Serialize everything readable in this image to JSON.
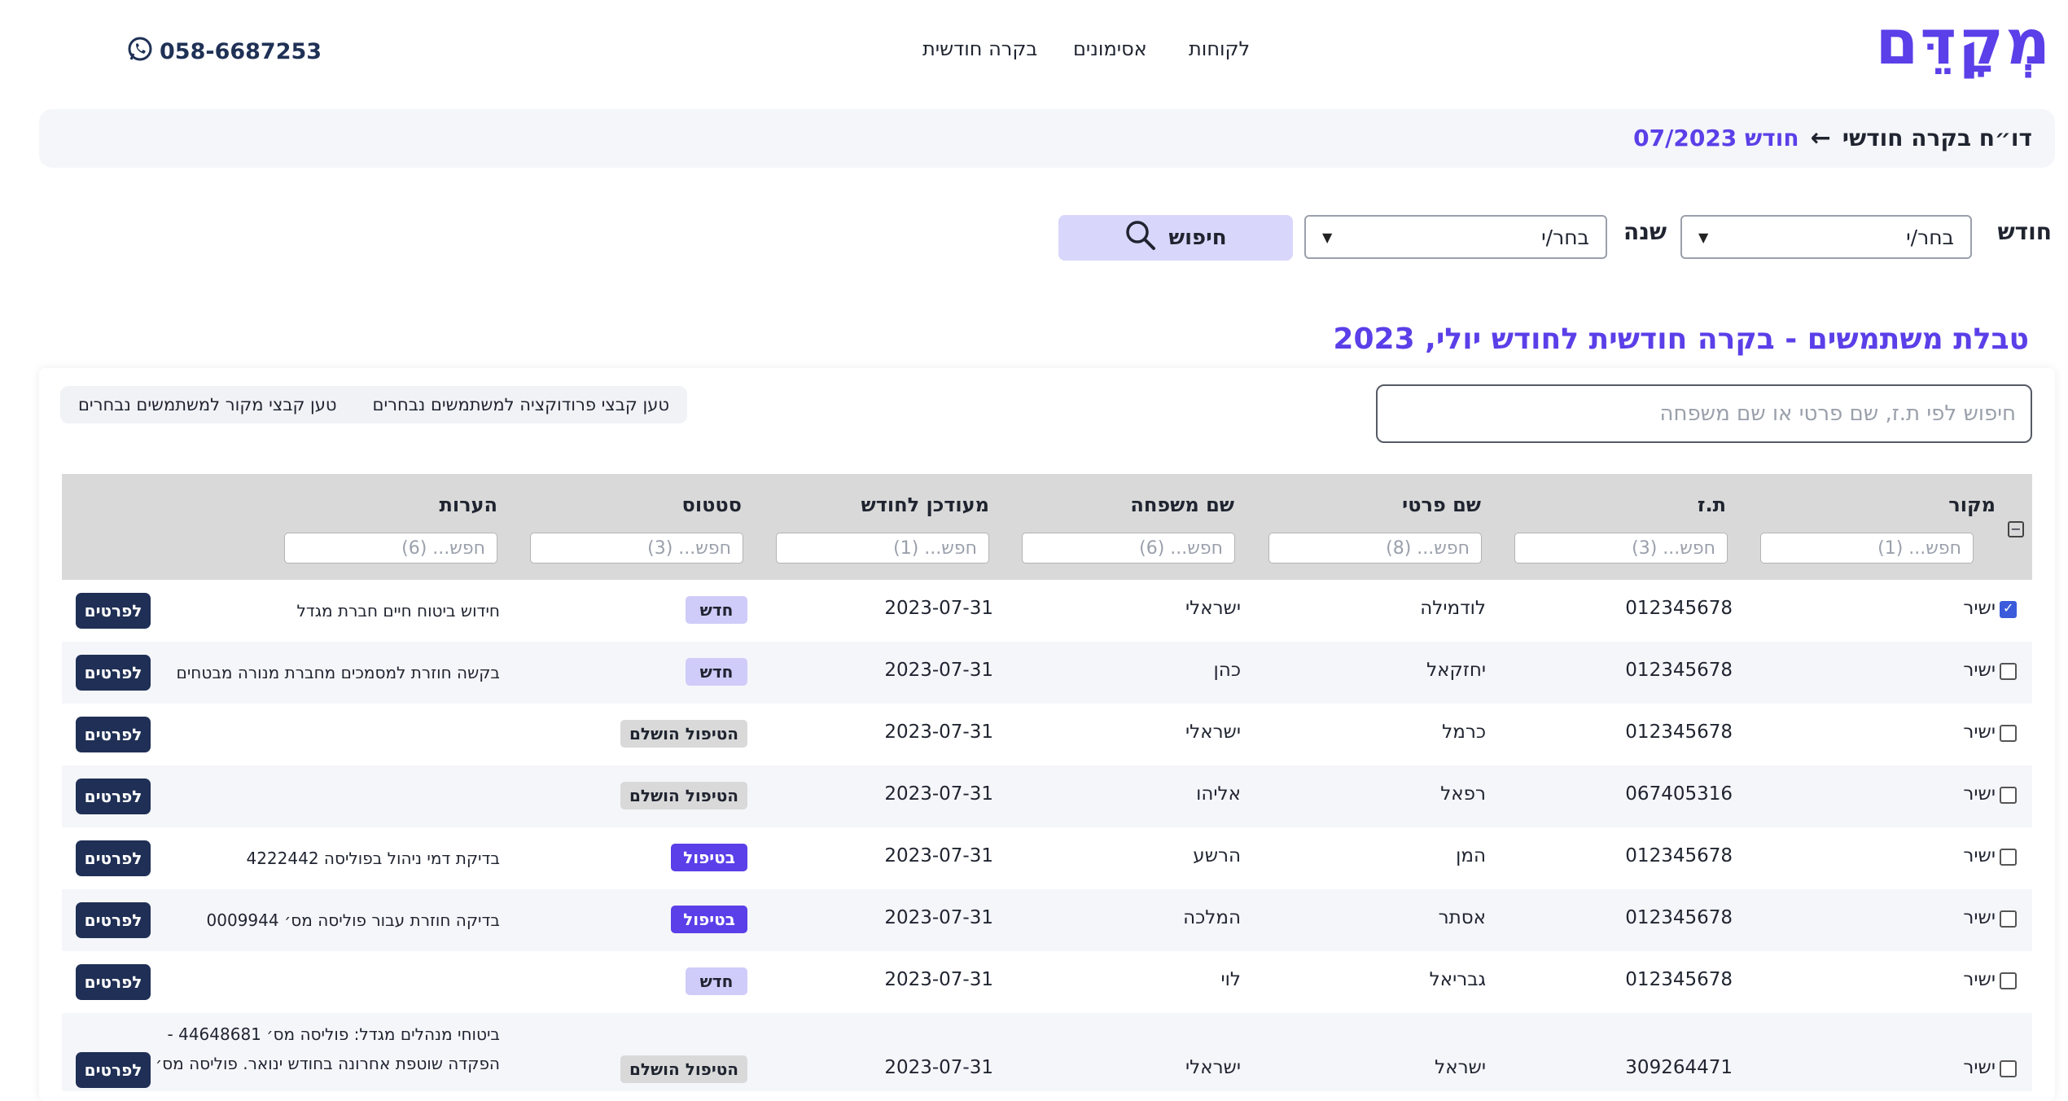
{
  "header": {
    "logo": "מְקָדֵּם",
    "nav": [
      "לקוחות",
      "אסימונים",
      "בקרה חודשית"
    ],
    "phone": "058-6687253"
  },
  "breadcrumb": {
    "parent": "דו״ח בקרה חודשי",
    "arrow": "←",
    "current": "חודש 07/2023"
  },
  "filters": {
    "month_label": "חודש",
    "month_value": "בחר/י",
    "year_label": "שנה",
    "year_value": "בחר/י",
    "search_button": "חיפוש"
  },
  "section_title": "טבלת משתמשים - בקרה חודשית לחודש יולי, 2023",
  "toolbar": {
    "load_production": "טען קבצי פרודוקציה למשתמשים נבחרים",
    "load_source": "טען קבצי מקור למשתמשים נבחרים"
  },
  "global_search_placeholder": "חיפוש לפי ת.ז, שם פרטי או שם משפחה",
  "columns": [
    {
      "label": "מקור",
      "placeholder": "חפש... (1)"
    },
    {
      "label": "ת.ז",
      "placeholder": "חפש... (3)"
    },
    {
      "label": "שם פרטי",
      "placeholder": "חפש... (8)"
    },
    {
      "label": "שם משפחה",
      "placeholder": "חפש... (6)"
    },
    {
      "label": "מעודכן לחודש",
      "placeholder": "חפש... (1)"
    },
    {
      "label": "סטטוס",
      "placeholder": "חפש... (3)"
    },
    {
      "label": "הערות",
      "placeholder": "חפש... (6)"
    }
  ],
  "details_label": "לפרטים",
  "rows": [
    {
      "checked": true,
      "source": "ישיר",
      "id": "012345678",
      "first": "לודמילה",
      "last": "ישראלי",
      "month": "2023-07-31",
      "status": "חדש",
      "status_kind": "new",
      "notes": [
        "חידוש ביטוח חיים חברת מגדל"
      ]
    },
    {
      "checked": false,
      "source": "ישיר",
      "id": "012345678",
      "first": "יחזקאל",
      "last": "כהן",
      "month": "2023-07-31",
      "status": "חדש",
      "status_kind": "new",
      "notes": [
        "בקשה חוזרת למסמכים מחברת מנורה מבטחים"
      ]
    },
    {
      "checked": false,
      "source": "ישיר",
      "id": "012345678",
      "first": "כרמל",
      "last": "ישראלי",
      "month": "2023-07-31",
      "status": "הטיפול הושלם",
      "status_kind": "done",
      "notes": []
    },
    {
      "checked": false,
      "source": "ישיר",
      "id": "067405316",
      "first": "רפאל",
      "last": "אליהו",
      "month": "2023-07-31",
      "status": "הטיפול הושלם",
      "status_kind": "done",
      "notes": []
    },
    {
      "checked": false,
      "source": "ישיר",
      "id": "012345678",
      "first": "המן",
      "last": "הרשע",
      "month": "2023-07-31",
      "status": "בטיפול",
      "status_kind": "prog",
      "notes": [
        "בדיקת דמי ניהול בפוליסה 4222442"
      ]
    },
    {
      "checked": false,
      "source": "ישיר",
      "id": "012345678",
      "first": "אסתר",
      "last": "המלכה",
      "month": "2023-07-31",
      "status": "בטיפול",
      "status_kind": "prog",
      "notes": [
        "בדיקה חוזרת עבור פוליסה מס׳ 0009944"
      ]
    },
    {
      "checked": false,
      "source": "ישיר",
      "id": "012345678",
      "first": "גבריאל",
      "last": "לוי",
      "month": "2023-07-31",
      "status": "חדש",
      "status_kind": "new",
      "notes": []
    },
    {
      "checked": false,
      "source": "ישיר",
      "id": "309264471",
      "first": "ישראל",
      "last": "ישראלי",
      "month": "2023-07-31",
      "status": "הטיפול הושלם",
      "status_kind": "done",
      "notes": [
        "ביטוחי מנהלים מגדל: פוליסה מס׳ 44648681 -",
        "הפקדה שוטפת אחרונה בחודש ינואר. פוליסה מס׳"
      ]
    }
  ],
  "colors": {
    "brand": "#5b3fe8",
    "navy": "#1f2f55",
    "badge_new": "#cfccf9",
    "badge_done": "#d9d9d9",
    "badge_progress": "#5b3fe8"
  }
}
